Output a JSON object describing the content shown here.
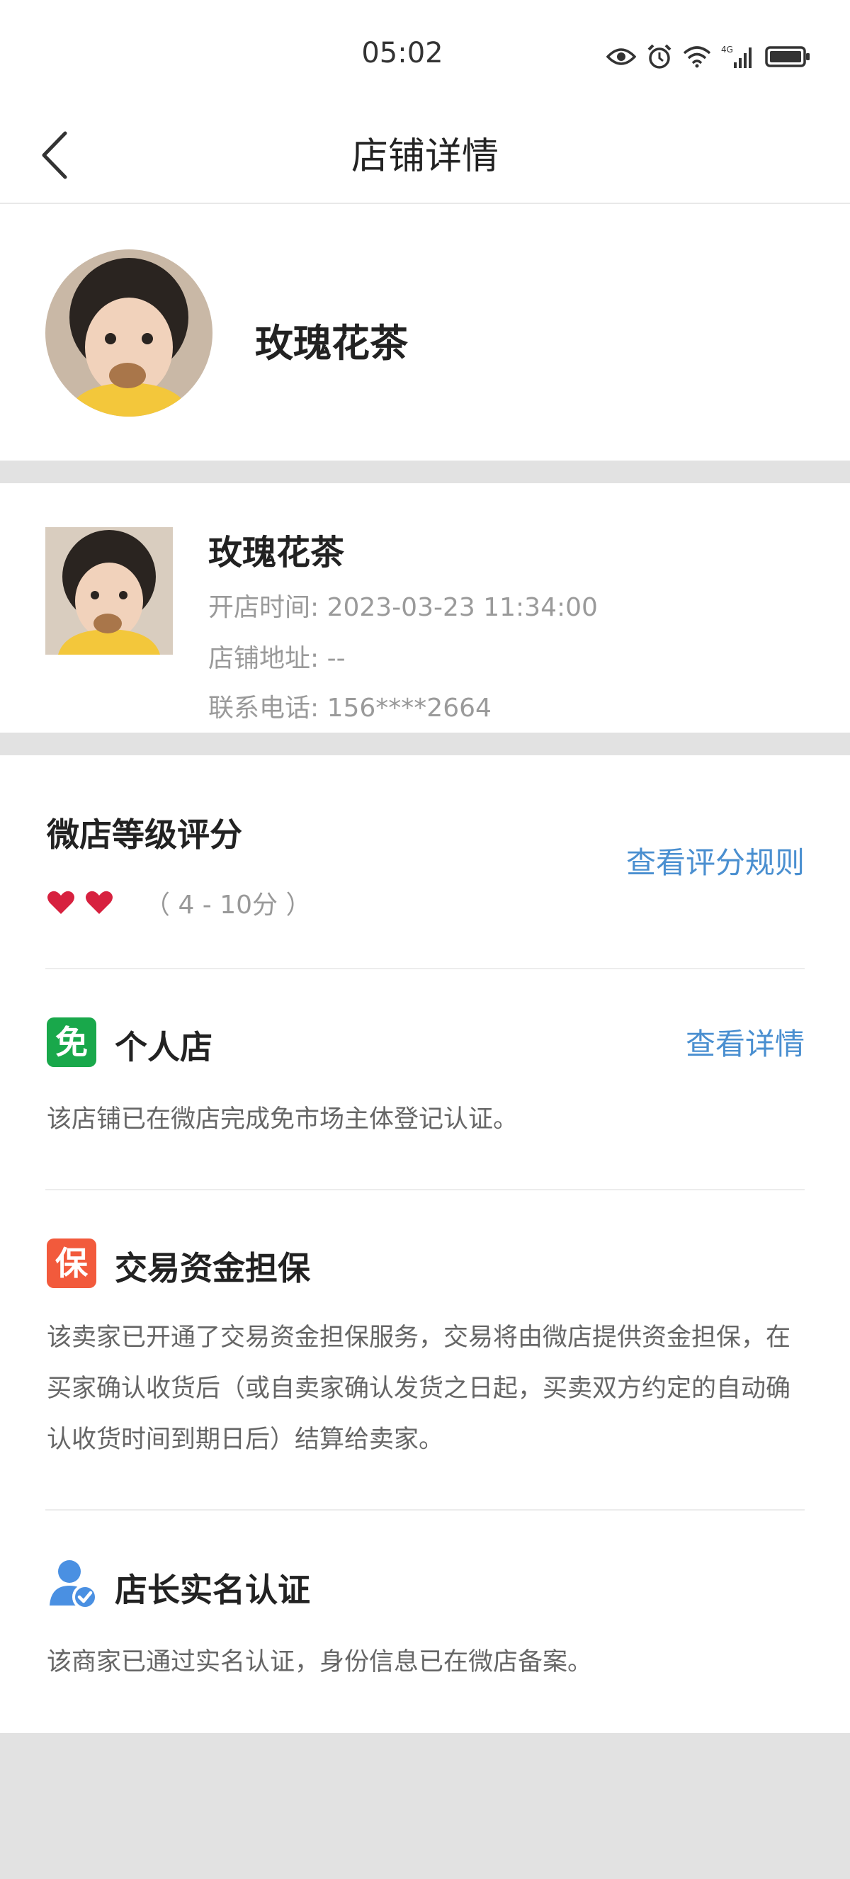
{
  "status_bar": {
    "time": "05:02",
    "network": "4G"
  },
  "header": {
    "title": "店铺详情"
  },
  "shop": {
    "name": "玫瑰花茶"
  },
  "info": {
    "name": "玫瑰花茶",
    "open_time": "开店时间: 2023-03-23 11:34:00",
    "address": "店铺地址: --",
    "phone": "联系电话: 156****2664"
  },
  "rating": {
    "title": "微店等级评分",
    "link": "查看评分规则",
    "hearts": 2,
    "range": "（ 4 - 10分 ）",
    "heart_color": "#d7213f"
  },
  "sections": [
    {
      "badge": "免",
      "badge_color": "#19a84b",
      "title": "个人店",
      "link": "查看详情",
      "desc": "该店铺已在微店完成免市场主体登记认证。"
    },
    {
      "badge": "保",
      "badge_color": "#f25a3c",
      "title": "交易资金担保",
      "desc": "该卖家已开通了交易资金担保服务，交易将由微店提供资金担保，在买家确认收货后（或自卖家确认发货之日起，买卖双方约定的自动确认收货时间到期日后）结算给卖家。"
    },
    {
      "icon": "verified-user-icon",
      "title": "店长实名认证",
      "desc": "该商家已通过实名认证，身份信息已在微店备案。"
    }
  ],
  "colors": {
    "link": "#4a8fd0",
    "background": "#e2e2e2"
  }
}
